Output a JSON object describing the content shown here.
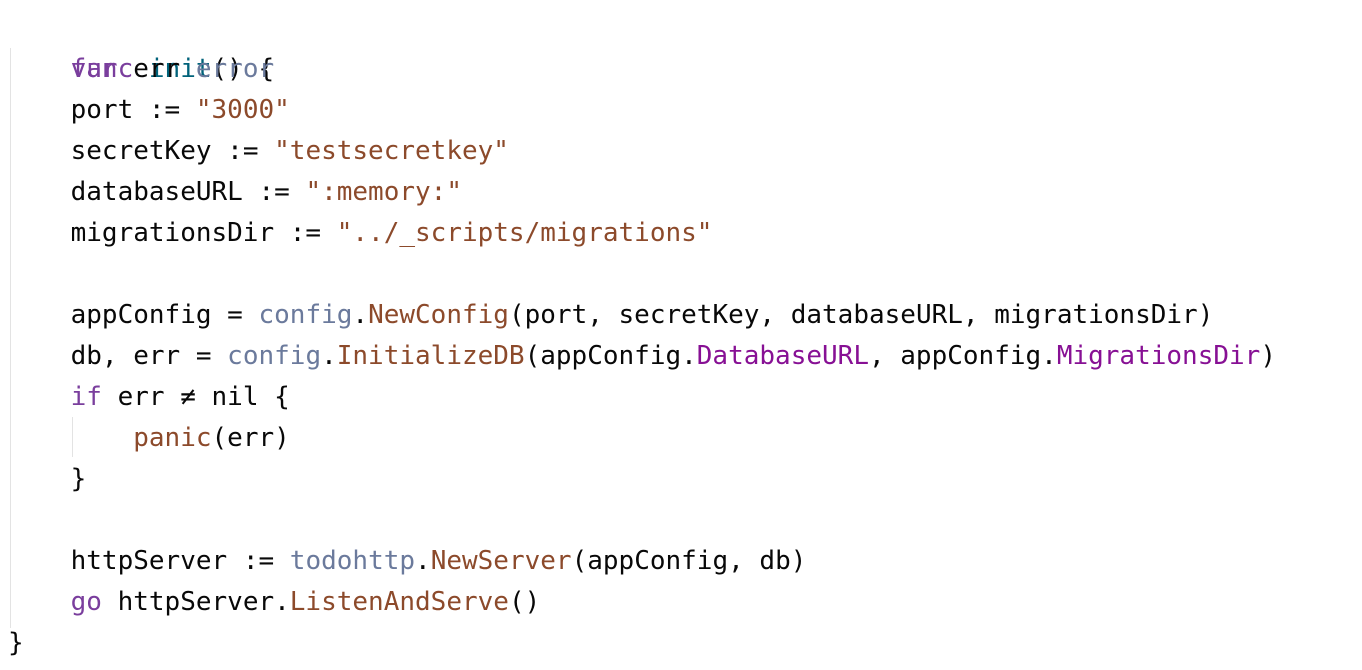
{
  "code": {
    "l1": {
      "kw": "func",
      "name": "init",
      "rest": "() {"
    },
    "l2": {
      "kw": "var",
      "ident": "err",
      "type": "error"
    },
    "l3": {
      "ident": "port",
      "op": ":=",
      "str": "\"3000\""
    },
    "l4": {
      "ident": "secretKey",
      "op": ":=",
      "str": "\"testsecretkey\""
    },
    "l5": {
      "ident": "databaseURL",
      "op": ":=",
      "str": "\":memory:\""
    },
    "l6": {
      "ident": "migrationsDir",
      "op": ":=",
      "str": "\"../_scripts/migrations\""
    },
    "l8": {
      "ident": "appConfig",
      "op": "=",
      "pkg": "config",
      "fn": "NewConfig",
      "args": "(port, secretKey, databaseURL, migrationsDir)"
    },
    "l9": {
      "ident": "db, err",
      "op": "=",
      "pkg": "config",
      "fn": "InitializeDB",
      "a1": "(appConfig.",
      "f1": "DatabaseURL",
      "a2": ", appConfig.",
      "f2": "MigrationsDir",
      "a3": ")"
    },
    "l10": {
      "kw": "if",
      "rest": "err ≠ nil {"
    },
    "l11": {
      "fn": "panic",
      "args": "(err)"
    },
    "l12": {
      "text": "}"
    },
    "l14": {
      "ident": "httpServer",
      "op": ":=",
      "pkg": "todohttp",
      "fn": "NewServer",
      "args": "(appConfig, db)"
    },
    "l15": {
      "kw": "go",
      "ident": "httpServer.",
      "fn": "ListenAndServe",
      "args": "()"
    },
    "l16": {
      "text": "}"
    }
  }
}
